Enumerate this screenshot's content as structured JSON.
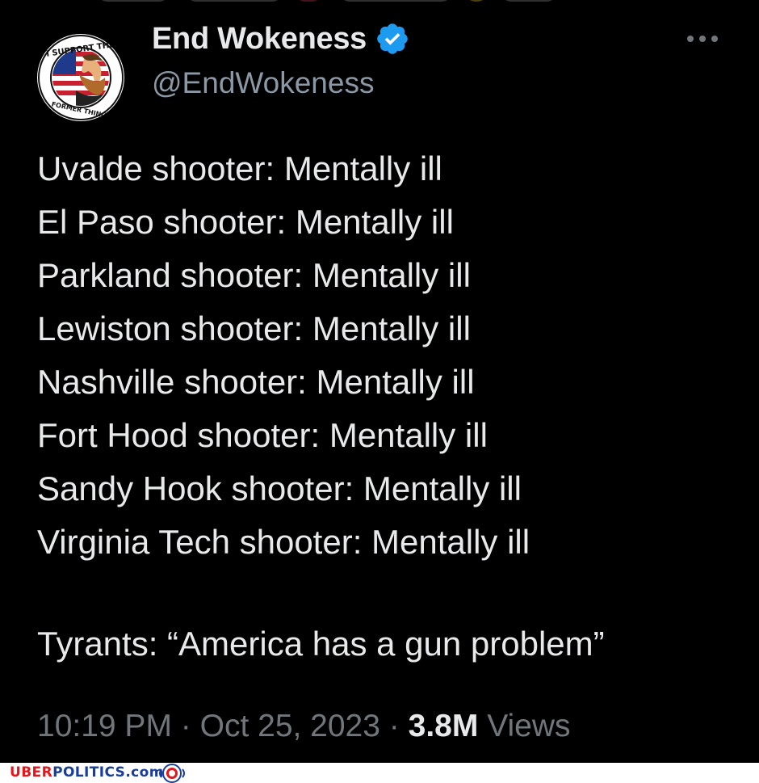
{
  "tweet": {
    "display_name": "End Wokeness",
    "handle": "@EndWokeness",
    "avatar": {
      "icon": "patriot-bearded-man-badge-icon",
      "top_text": "I SUPPORT THE",
      "bottom_text": "FORMER THINGS"
    },
    "verified_icon": "verified-badge-icon",
    "menu_icon": "more-options-icon",
    "body_lines": [
      "Uvalde shooter: Mentally ill",
      "El Paso shooter: Mentally ill",
      "Parkland shooter: Mentally ill",
      "Lewiston shooter: Mentally ill",
      "Nashville shooter: Mentally ill",
      "Fort Hood shooter: Mentally ill",
      "Sandy Hook shooter: Mentally ill",
      "Virginia Tech shooter: Mentally ill"
    ],
    "closing_line": "Tyrants: “America has a gun problem”",
    "time": "10:19 PM",
    "date": "Oct 25, 2023",
    "separator": "·",
    "views_count": "3.8M",
    "views_label": "Views"
  },
  "watermark": {
    "uber": "UBER",
    "politics": "POLITICS",
    "suffix": ".com",
    "logo_icon": "uberpolitics-mascot-icon"
  },
  "colors": {
    "background": "#000000",
    "text_primary": "#e7e9ea",
    "text_secondary": "#71767b",
    "verified_blue": "#1d9bf0",
    "watermark_red": "#e4161b",
    "watermark_blue": "#1b3d9a"
  }
}
